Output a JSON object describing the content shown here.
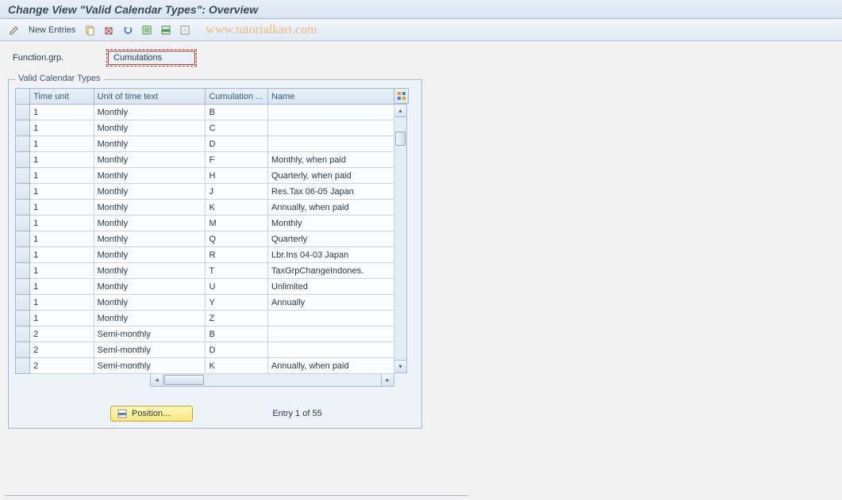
{
  "title": "Change View \"Valid Calendar Types\": Overview",
  "toolbar": {
    "new_entries": "New Entries"
  },
  "watermark": "www.tutorialkart.com",
  "field": {
    "label": "Function.grp.",
    "value": "Cumulations"
  },
  "group": {
    "title": "Valid Calendar Types",
    "columns": [
      "Time unit",
      "Unit of time text",
      "Cumulation ...",
      "Name"
    ],
    "rows": [
      {
        "time_unit": "1",
        "unit_text": "Monthly",
        "cumulation": "B",
        "name": ""
      },
      {
        "time_unit": "1",
        "unit_text": "Monthly",
        "cumulation": "C",
        "name": ""
      },
      {
        "time_unit": "1",
        "unit_text": "Monthly",
        "cumulation": "D",
        "name": ""
      },
      {
        "time_unit": "1",
        "unit_text": "Monthly",
        "cumulation": "F",
        "name": "Monthly, when paid"
      },
      {
        "time_unit": "1",
        "unit_text": "Monthly",
        "cumulation": "H",
        "name": "Quarterly, when paid"
      },
      {
        "time_unit": "1",
        "unit_text": "Monthly",
        "cumulation": "J",
        "name": "Res.Tax 06-05  Japan"
      },
      {
        "time_unit": "1",
        "unit_text": "Monthly",
        "cumulation": "K",
        "name": "Annually, when paid"
      },
      {
        "time_unit": "1",
        "unit_text": "Monthly",
        "cumulation": "M",
        "name": "Monthly"
      },
      {
        "time_unit": "1",
        "unit_text": "Monthly",
        "cumulation": "Q",
        "name": "Quarterly"
      },
      {
        "time_unit": "1",
        "unit_text": "Monthly",
        "cumulation": "R",
        "name": "Lbr.Ins 04-03  Japan"
      },
      {
        "time_unit": "1",
        "unit_text": "Monthly",
        "cumulation": "T",
        "name": "TaxGrpChangeIndones."
      },
      {
        "time_unit": "1",
        "unit_text": "Monthly",
        "cumulation": "U",
        "name": "Unlimited"
      },
      {
        "time_unit": "1",
        "unit_text": "Monthly",
        "cumulation": "Y",
        "name": "Annually"
      },
      {
        "time_unit": "1",
        "unit_text": "Monthly",
        "cumulation": "Z",
        "name": ""
      },
      {
        "time_unit": "2",
        "unit_text": "Semi-monthly",
        "cumulation": "B",
        "name": ""
      },
      {
        "time_unit": "2",
        "unit_text": "Semi-monthly",
        "cumulation": "D",
        "name": ""
      },
      {
        "time_unit": "2",
        "unit_text": "Semi-monthly",
        "cumulation": "K",
        "name": "Annually, when paid"
      }
    ]
  },
  "footer": {
    "position_label": "Position...",
    "entry_text": "Entry 1 of 55"
  },
  "colors": {
    "accent": "#3a5a7a",
    "highlight_border": "#c0392b",
    "button_yellow": "#f8e880"
  }
}
